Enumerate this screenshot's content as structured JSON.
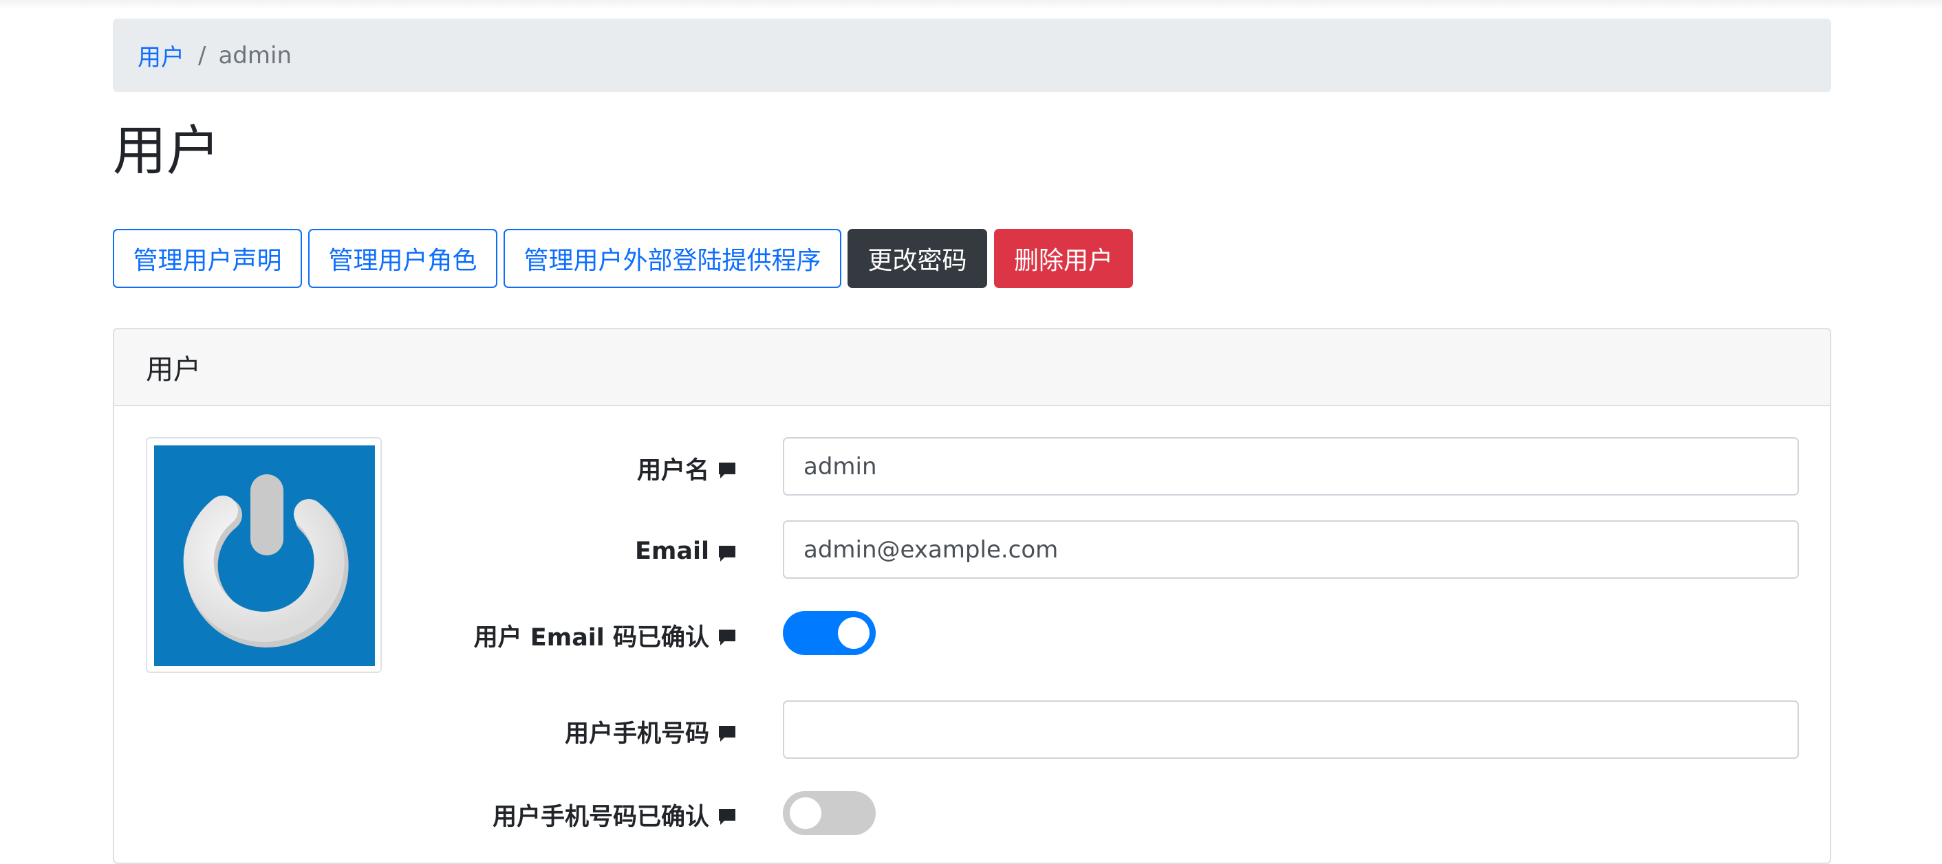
{
  "breadcrumb": {
    "parent": "用户",
    "separator": "/",
    "current": "admin"
  },
  "page_title": "用户",
  "toolbar": {
    "manage_claims": "管理用户声明",
    "manage_roles": "管理用户角色",
    "manage_external_logins": "管理用户外部登陆提供程序",
    "change_password": "更改密码",
    "delete_user": "删除用户"
  },
  "card": {
    "header": "用户"
  },
  "form": {
    "username": {
      "label": "用户名",
      "value": "admin"
    },
    "email": {
      "label": "Email",
      "value": "admin@example.com"
    },
    "email_confirmed": {
      "label": "用户 Email 码已确认",
      "checked": true
    },
    "phone": {
      "label": "用户手机号码",
      "value": ""
    },
    "phone_confirmed": {
      "label": "用户手机号码已确认",
      "checked": false
    }
  },
  "icons": {
    "label_hint": "comment-icon",
    "avatar": "power-logo"
  },
  "colors": {
    "primary": "#0d6efd",
    "dark": "#343a40",
    "danger": "#dc3545",
    "switch_on": "#007bff",
    "switch_off": "#cccccc",
    "avatar_bg": "#0b79bd"
  }
}
